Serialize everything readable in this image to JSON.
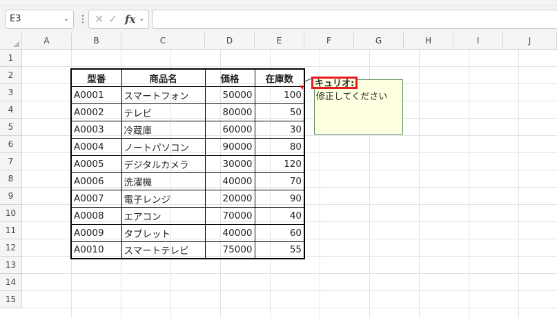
{
  "formula_bar": {
    "name_box": "E3",
    "formula": ""
  },
  "columns": [
    "A",
    "B",
    "C",
    "D",
    "E",
    "F",
    "G",
    "H",
    "I",
    "J"
  ],
  "rows": [
    "1",
    "2",
    "3",
    "4",
    "5",
    "6",
    "7",
    "8",
    "9",
    "10",
    "11",
    "12",
    "13",
    "14",
    "15"
  ],
  "table": {
    "headers": [
      "型番",
      "商品名",
      "価格",
      "在庫数"
    ],
    "rows": [
      [
        "A0001",
        "スマートフォン",
        "50000",
        "100"
      ],
      [
        "A0002",
        "テレビ",
        "80000",
        "50"
      ],
      [
        "A0003",
        "冷蔵庫",
        "60000",
        "30"
      ],
      [
        "A0004",
        "ノートパソコン",
        "90000",
        "80"
      ],
      [
        "A0005",
        "デジタルカメラ",
        "30000",
        "120"
      ],
      [
        "A0006",
        "洗濯機",
        "40000",
        "70"
      ],
      [
        "A0007",
        "電子レンジ",
        "20000",
        "90"
      ],
      [
        "A0008",
        "エアコン",
        "70000",
        "40"
      ],
      [
        "A0009",
        "タブレット",
        "40000",
        "60"
      ],
      [
        "A0010",
        "スマートテレビ",
        "75000",
        "55"
      ]
    ]
  },
  "comment": {
    "author": "キュリオ:",
    "text": "修正してください"
  },
  "colors": {
    "comment_bg": "#ffffe1",
    "highlight_border": "#e8191e",
    "comment_indicator": "#d01c1c"
  },
  "icons": [
    "chevron-down-icon",
    "more-vertical-icon",
    "cancel-icon",
    "enter-icon",
    "insert-function-icon"
  ]
}
